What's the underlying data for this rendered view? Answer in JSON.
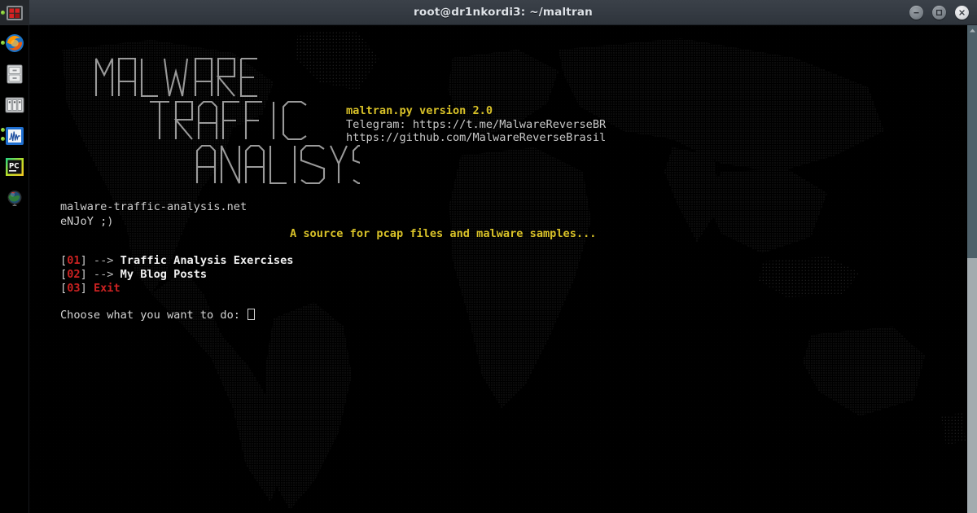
{
  "window": {
    "title": "root@dr1nkordi3: ~/maltran",
    "controls": [
      {
        "name": "minimize-button",
        "glyph": "minimize"
      },
      {
        "name": "maximize-button",
        "glyph": "maximize"
      },
      {
        "name": "close-button",
        "glyph": "close"
      }
    ]
  },
  "dock": {
    "app_icon": "terminal-icon",
    "items": [
      {
        "name": "firefox-icon",
        "label": "Firefox",
        "running": true
      },
      {
        "name": "file-manager-icon",
        "label": "Files",
        "running": false
      },
      {
        "name": "text-editor-icon",
        "label": "Editor",
        "running": false
      },
      {
        "name": "wireshark-icon",
        "label": "Wireshark",
        "running": true
      },
      {
        "name": "pycharm-icon",
        "label": "PyCharm",
        "running": false
      },
      {
        "name": "globe-icon",
        "label": "Browser",
        "running": false
      }
    ]
  },
  "terminal": {
    "banner_ascii": "___  ___  ___   _    _    _  _   _     ___   ___   ___\n|   \\/   | / _ \\ | |  | |  | || | /_\\  | _ \\ | __| |___|\n| |\\  /| ||  _  || |__| |__| || |/ _ \\ |   / | _|  |___|\n|_| \\/ |_||_| |_||____|____| |_|_/ \\_\\|_|_\\ |___| |___|",
    "banner_line_1": "MALWARE",
    "banner_line_2": "TRAFFIC",
    "banner_line_3": "ANALISYS",
    "version_line": "maltran.py version 2.0",
    "telegram_line": "Telegram: https://t.me/MalwareReverseBR",
    "github_line": "https://github.com/MalwareReverseBrasil",
    "site_line": "malware-traffic-analysis.net",
    "enjoy_line": "eNJoY ;)",
    "tagline": "A source for pcap files and malware samples...",
    "menu": [
      {
        "open_bracket": "[",
        "number": "01",
        "close_bracket": "]",
        "arrow": " --> ",
        "label": "Traffic Analysis Exercises",
        "label_color": "white"
      },
      {
        "open_bracket": "[",
        "number": "02",
        "close_bracket": "]",
        "arrow": " --> ",
        "label": "My Blog Posts",
        "label_color": "white"
      },
      {
        "open_bracket": "[",
        "number": "03",
        "close_bracket": "]",
        "arrow": " ",
        "label": "Exit",
        "label_color": "red"
      }
    ],
    "prompt_text": "Choose what you want to do: ",
    "input_value": ""
  },
  "colors": {
    "titlebar": "#343a42",
    "title_text": "#dfe3e8",
    "terminal_bg": "#000000",
    "accent_gold": "#d8c128",
    "accent_red": "#cc2222",
    "body_text": "#cfcfcf",
    "scrollbar_track": "#4e6069",
    "scrollbar_thumb": "#a3abaf",
    "running_dot": "#7fc422"
  },
  "scrollbar": {
    "up_arrow": "▲"
  }
}
